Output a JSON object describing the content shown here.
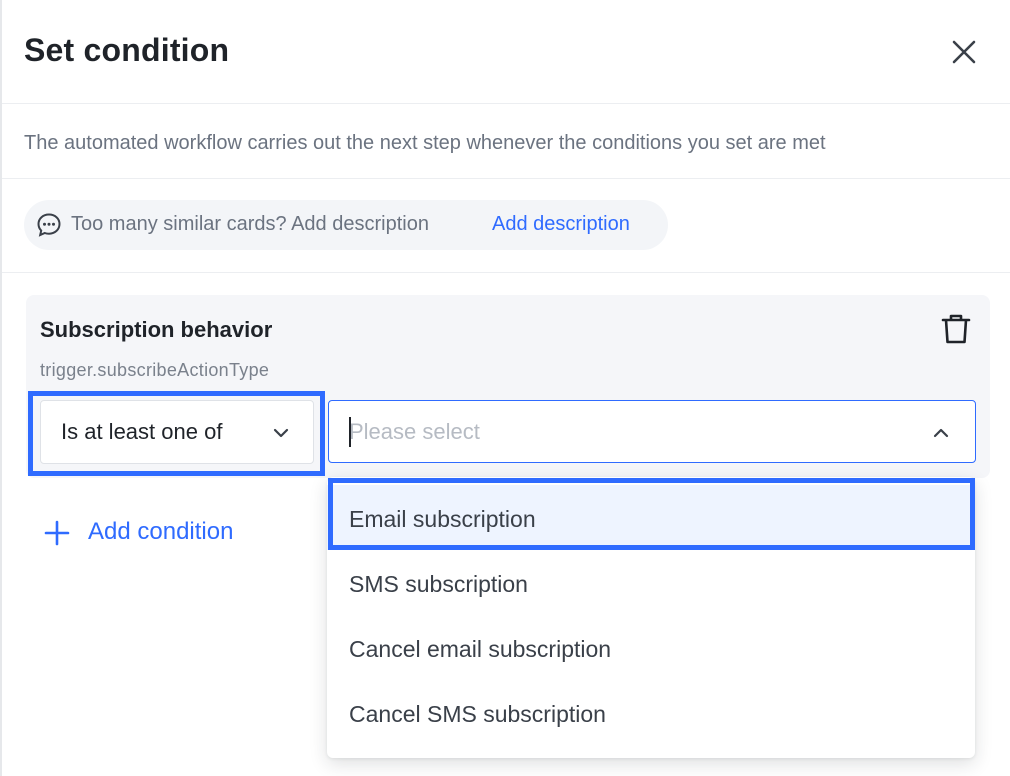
{
  "dialog": {
    "title": "Set condition",
    "description": "The automated workflow carries out the next step whenever the conditions you set are met",
    "close_icon": "close-icon"
  },
  "hint": {
    "icon": "chat-bubble-icon",
    "text": "Too many similar cards? Add description",
    "link": "Add description"
  },
  "condition_card": {
    "title": "Subscription behavior",
    "field_key": "trigger.subscribeActionType",
    "delete_icon": "trash-icon",
    "operator": {
      "selected": "Is at least one of",
      "icon": "chevron-down-icon"
    },
    "value": {
      "placeholder": "Please select",
      "value": "",
      "icon": "chevron-up-icon"
    }
  },
  "add_condition": {
    "label": "Add condition",
    "icon": "plus-icon"
  },
  "dropdown": {
    "options": [
      {
        "label": "Email subscription",
        "highlighted": true
      },
      {
        "label": "SMS subscription",
        "highlighted": false
      },
      {
        "label": "Cancel email subscription",
        "highlighted": false
      },
      {
        "label": "Cancel SMS subscription",
        "highlighted": false
      }
    ]
  },
  "colors": {
    "accent": "#2f6bff",
    "text_primary": "#1f2329",
    "text_secondary": "#6b7380",
    "card_bg": "#f5f6f9",
    "option_hover_bg": "#eef4ff",
    "highlight_border": "#2f6bff"
  }
}
